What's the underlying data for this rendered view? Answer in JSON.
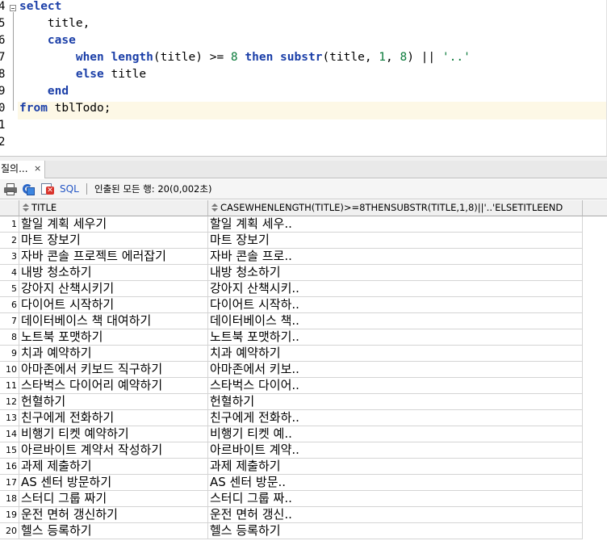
{
  "editor": {
    "line_numbers": [
      "4",
      "5",
      "6",
      "7",
      "8",
      "9",
      "0",
      "1",
      "2"
    ],
    "lines": [
      [
        {
          "t": "select",
          "c": "kw"
        }
      ],
      [
        {
          "t": "    title,",
          "c": ""
        }
      ],
      [
        {
          "t": "    ",
          "c": ""
        },
        {
          "t": "case",
          "c": "kw"
        }
      ],
      [
        {
          "t": "        ",
          "c": ""
        },
        {
          "t": "when",
          "c": "kw"
        },
        {
          "t": " ",
          "c": ""
        },
        {
          "t": "length",
          "c": "kw"
        },
        {
          "t": "(title) >= ",
          "c": ""
        },
        {
          "t": "8",
          "c": "num"
        },
        {
          "t": " ",
          "c": ""
        },
        {
          "t": "then",
          "c": "kw"
        },
        {
          "t": " ",
          "c": ""
        },
        {
          "t": "substr",
          "c": "kw"
        },
        {
          "t": "(title, ",
          "c": ""
        },
        {
          "t": "1",
          "c": "num"
        },
        {
          "t": ", ",
          "c": ""
        },
        {
          "t": "8",
          "c": "num"
        },
        {
          "t": ") || ",
          "c": ""
        },
        {
          "t": "'..'",
          "c": "str"
        }
      ],
      [
        {
          "t": "        ",
          "c": ""
        },
        {
          "t": "else",
          "c": "kw"
        },
        {
          "t": " title",
          "c": ""
        }
      ],
      [
        {
          "t": "    ",
          "c": ""
        },
        {
          "t": "end",
          "c": "kw"
        }
      ],
      [
        {
          "t": "from",
          "c": "kw"
        },
        {
          "t": " tblTodo;",
          "c": ""
        }
      ],
      [],
      []
    ]
  },
  "results_tab": {
    "label": "질의...",
    "close": "×"
  },
  "toolbar": {
    "print_icon": "print-icon",
    "refresh_icon": "refresh-icon",
    "cancel_icon": "cancel-icon",
    "sql_label": "SQL",
    "status": "인출된 모든 행: 20(0,002초)"
  },
  "grid": {
    "columns": [
      "TITLE",
      "CASEWHENLENGTH(TITLE)>=8THENSUBSTR(TITLE,1,8)||'..'ELSETITLEEND"
    ],
    "rows": [
      [
        "1",
        "할일 계획 세우기",
        "할일 계획 세우.."
      ],
      [
        "2",
        "마트 장보기",
        "마트 장보기"
      ],
      [
        "3",
        "자바 콘솔 프로젝트 에러잡기",
        "자바 콘솔 프로.."
      ],
      [
        "4",
        "내방 청소하기",
        "내방 청소하기"
      ],
      [
        "5",
        "강아지 산책시키기",
        "강아지 산책시키.."
      ],
      [
        "6",
        "다이어트 시작하기",
        "다이어트 시작하.."
      ],
      [
        "7",
        "데이터베이스 책 대여하기",
        "데이터베이스 책.."
      ],
      [
        "8",
        "노트북 포맷하기",
        "노트북 포맷하기.."
      ],
      [
        "9",
        "치과 예약하기",
        "치과 예약하기"
      ],
      [
        "10",
        "아마존에서 키보드 직구하기",
        "아마존에서 키보.."
      ],
      [
        "11",
        "스타벅스 다이어리 예약하기",
        "스타벅스 다이어.."
      ],
      [
        "12",
        "헌혈하기",
        "헌혈하기"
      ],
      [
        "13",
        "친구에게 전화하기",
        "친구에게 전화하.."
      ],
      [
        "14",
        "비행기 티켓 예약하기",
        "비행기 티켓 예.."
      ],
      [
        "15",
        "아르바이트 계약서 작성하기",
        "아르바이트 계약.."
      ],
      [
        "16",
        "과제 제출하기",
        "과제 제출하기"
      ],
      [
        "17",
        "AS 센터 방문하기",
        "AS 센터 방문.."
      ],
      [
        "18",
        "스터디 그룹 짜기",
        "스터디 그룹 짜.."
      ],
      [
        "19",
        "운전 면허 갱신하기",
        "운전 면허 갱신.."
      ],
      [
        "20",
        "헬스 등록하기",
        "헬스 등록하기"
      ]
    ]
  }
}
